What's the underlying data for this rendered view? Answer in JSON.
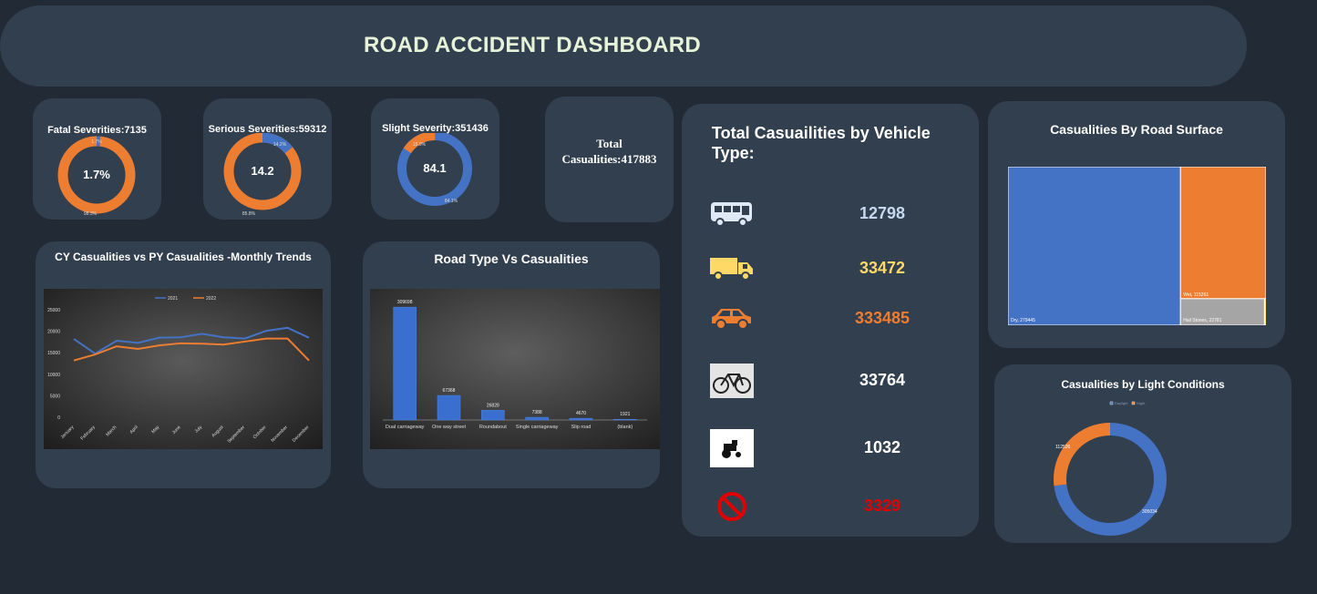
{
  "header": {
    "title": "ROAD ACCIDENT DASHBOARD"
  },
  "kpis": {
    "fatal": {
      "label": "Fatal Severities:7135",
      "center": "1.7%",
      "pct": 1.7,
      "small_top": "1.7%",
      "small_bottom": "98.3%"
    },
    "serious": {
      "label": "Serious Severities:59312",
      "center": "14.2",
      "pct": 14.2,
      "small_top": "14.2%",
      "small_bottom": "85.8%"
    },
    "slight": {
      "label": "Slight Severity:351436",
      "center": "84.1",
      "pct": 84.1,
      "small_top": "15.9%",
      "small_bottom": "84.1%"
    },
    "total": {
      "label": "Total Casualities:417883"
    }
  },
  "vehicle": {
    "title": "Total Casuailities by Vehicle Type:",
    "rows": [
      {
        "icon": "bus-icon",
        "value": "12798",
        "color": "#c7d8ef"
      },
      {
        "icon": "truck-icon",
        "value": "33472",
        "color": "#ffd966"
      },
      {
        "icon": "car-icon",
        "value": "333485",
        "color": "#ed7d31"
      },
      {
        "icon": "bicycle-icon",
        "value": "33764",
        "color": "#ffffff"
      },
      {
        "icon": "tractor-icon",
        "value": "1032",
        "color": "#ffffff"
      },
      {
        "icon": "prohibited-icon",
        "value": "3329",
        "color": "#e00000"
      }
    ]
  },
  "road_surface": {
    "title": "Casualities By Road Surface"
  },
  "light": {
    "title": "Casualities by Light Conditions"
  },
  "trends": {
    "title": "CY Casualities vs PY Casualities -Monthly Trends"
  },
  "road_type": {
    "title": "Road Type Vs Casualities"
  },
  "chart_data": [
    {
      "type": "line",
      "title": "CY Casualities vs PY Casualities -Monthly Trends",
      "categories": [
        "January",
        "February",
        "March",
        "April",
        "May",
        "June",
        "July",
        "August",
        "September",
        "October",
        "November",
        "December"
      ],
      "series": [
        {
          "name": "2021",
          "color": "#4472c4",
          "values": [
            18200,
            14800,
            17800,
            17300,
            18500,
            18600,
            19400,
            18600,
            18300,
            20100,
            20800,
            18500
          ]
        },
        {
          "name": "2022",
          "color": "#ed7d31",
          "values": [
            13200,
            14600,
            16500,
            15900,
            16700,
            17200,
            17100,
            16900,
            17600,
            18300,
            18300,
            13200
          ]
        }
      ],
      "yticks": [
        "25000",
        "20000",
        "15000",
        "10000",
        "5000",
        "0"
      ],
      "ylim": [
        0,
        25000
      ],
      "legend": "top"
    },
    {
      "type": "bar",
      "title": "Road Type Vs Casualities",
      "categories": [
        "Dual carriageway",
        "One way street",
        "Roundabout",
        "Single carriageway",
        "Slip road",
        "(blank)"
      ],
      "values": [
        309698,
        67368,
        26828,
        7388,
        4670,
        1921
      ],
      "labels": [
        "309698",
        "67368",
        "26828",
        "7388",
        "4670",
        "1921"
      ],
      "ylim": [
        0,
        320000
      ]
    },
    {
      "type": "treemap",
      "title": "Casualities By Road Surface",
      "items": [
        {
          "name": "Dry",
          "value": 279445,
          "label": "Dry, 279445",
          "color": "#4472c4"
        },
        {
          "name": "Wet",
          "value": 115261,
          "label": "Wet, 115261",
          "color": "#ed7d31"
        },
        {
          "name": "Hail Stones",
          "value": 22781,
          "label": "Hail Stones, 22781",
          "color": "#a5a5a5"
        },
        {
          "name": "Other",
          "value": 396,
          "label": "",
          "color": "#ffc000"
        }
      ]
    },
    {
      "type": "pie",
      "title": "Casualities by Light Conditions",
      "series": [
        {
          "name": "Daylight",
          "value": 305034,
          "label": "305034",
          "color": "#4472c4"
        },
        {
          "name": "Night",
          "value": 112526,
          "label": "112526",
          "color": "#ed7d31"
        }
      ]
    }
  ]
}
